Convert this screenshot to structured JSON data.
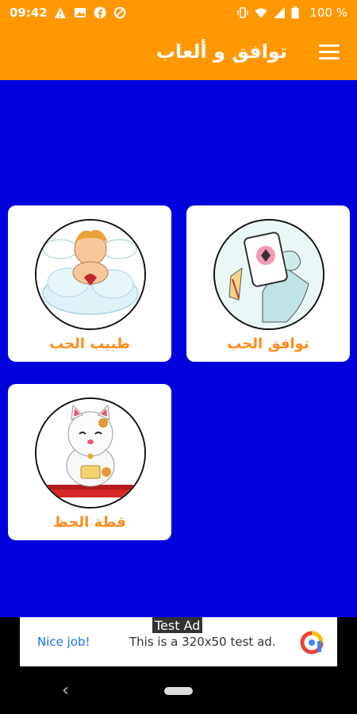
{
  "status_bar": {
    "time": "09:42",
    "left_icons": [
      "warning-icon",
      "image-icon",
      "facebook-icon",
      "data-saver-icon"
    ],
    "right_icons": [
      "vibrate-icon",
      "wifi-icon",
      "signal-icon",
      "battery-icon"
    ],
    "battery": "100 %"
  },
  "app_bar": {
    "title": "توافق و ألعاب",
    "menu_icon": "menu-icon",
    "background": "#ff9800"
  },
  "main": {
    "background": "#0000dd",
    "cards": [
      {
        "label": "توافق الحب",
        "image": "phone-in-hand-illustration"
      },
      {
        "label": "طبيب الحب",
        "image": "cupid-on-cloud-illustration"
      },
      {
        "label": "قطة الحظ",
        "image": "lucky-cat-illustration"
      }
    ],
    "label_color": "#ff8c1a"
  },
  "ad": {
    "tag": "Test Ad",
    "cta": "Nice job!",
    "text": "This is a 320x50 test ad."
  },
  "nav_bar": {
    "back_icon": "back-icon",
    "home_icon": "home-pill-icon"
  }
}
